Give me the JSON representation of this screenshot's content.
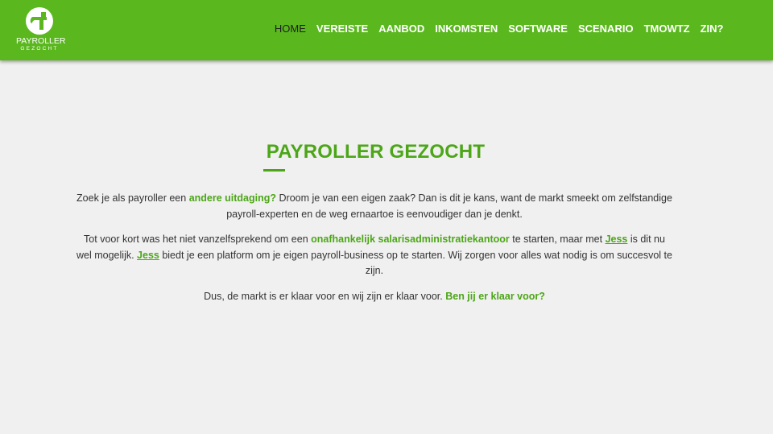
{
  "brand": {
    "name": "PAYROLLER",
    "tagline": "GEZOCHT",
    "logo_icon": "payroller-figure-icon",
    "color": "#5ab81e"
  },
  "nav": {
    "items": [
      {
        "label": "HOME",
        "active": true
      },
      {
        "label": "VEREISTE",
        "active": false
      },
      {
        "label": "AANBOD",
        "active": false
      },
      {
        "label": "INKOMSTEN",
        "active": false
      },
      {
        "label": "SOFTWARE",
        "active": false
      },
      {
        "label": "SCENARIO",
        "active": false
      },
      {
        "label": "TMOWTZ",
        "active": false
      },
      {
        "label": "ZIN?",
        "active": false
      }
    ]
  },
  "main": {
    "title": "PAYROLLER GEZOCHT",
    "accent_color": "#4ca617",
    "p1": {
      "before": "Zoek je als payroller een ",
      "highlight": "andere uitdaging?",
      "after": " Droom je van een eigen zaak? Dan is dit je kans, want de markt smeekt om zelfstandige payroll-experten en de weg ernaartoe is eenvoudiger dan je denkt."
    },
    "p2": {
      "before": "Tot voor kort was het niet vanzelfsprekend om een ",
      "highlight": "onafhankelijk salarisadministratiekantoor",
      "middle1": " te starten, maar met ",
      "link1": "Jess",
      "middle2": " is dit nu wel mogelijk. ",
      "link2": "Jess",
      "after": " biedt je een platform om je eigen payroll-business op te starten. Wij zorgen voor alles wat nodig is om succesvol te zijn."
    },
    "p3": {
      "before": "Dus, de markt is er klaar voor en wij zijn er klaar voor. ",
      "highlight": "Ben jij er klaar voor?"
    }
  }
}
